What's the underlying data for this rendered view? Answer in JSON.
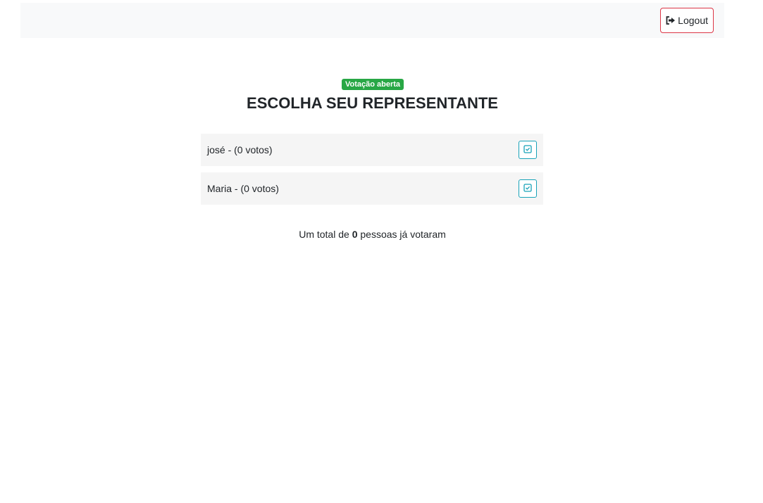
{
  "navbar": {
    "logout_label": "Logout",
    "logout_icon": "sign-out-icon"
  },
  "status_badge": "Votação aberta",
  "title": "ESCOLHA SEU REPRESENTANTE",
  "candidates": [
    {
      "label": "josé - (0 votos)",
      "action_icon": "check-square-icon"
    },
    {
      "label": "Maria - (0 votos)",
      "action_icon": "check-square-icon"
    }
  ],
  "total": {
    "prefix": "Um total de",
    "count": "0",
    "suffix": "pessoas já votaram"
  },
  "colors": {
    "navbar_bg": "#f8f9fa",
    "logout_border": "#dc3545",
    "badge_bg": "#28a745",
    "vote_button_border": "#17a2b8",
    "list_item_bg": "#f5f5f5"
  }
}
